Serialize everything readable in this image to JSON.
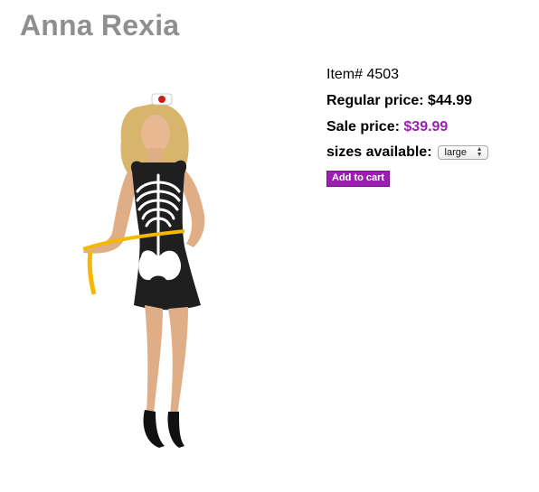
{
  "product": {
    "title": "Anna Rexia",
    "item_number_label": "Item#",
    "item_number": "4503",
    "regular_price_label": "Regular price:",
    "regular_price": "$44.99",
    "sale_price_label": "Sale price:",
    "sale_price": "$39.99",
    "sizes_label": "sizes available:",
    "selected_size": "large",
    "add_to_cart_label": "Add to cart",
    "image_icon": "costume-model-photo"
  },
  "colors": {
    "title_gray": "#8f8f8f",
    "accent_purple": "#9b1fb0"
  }
}
